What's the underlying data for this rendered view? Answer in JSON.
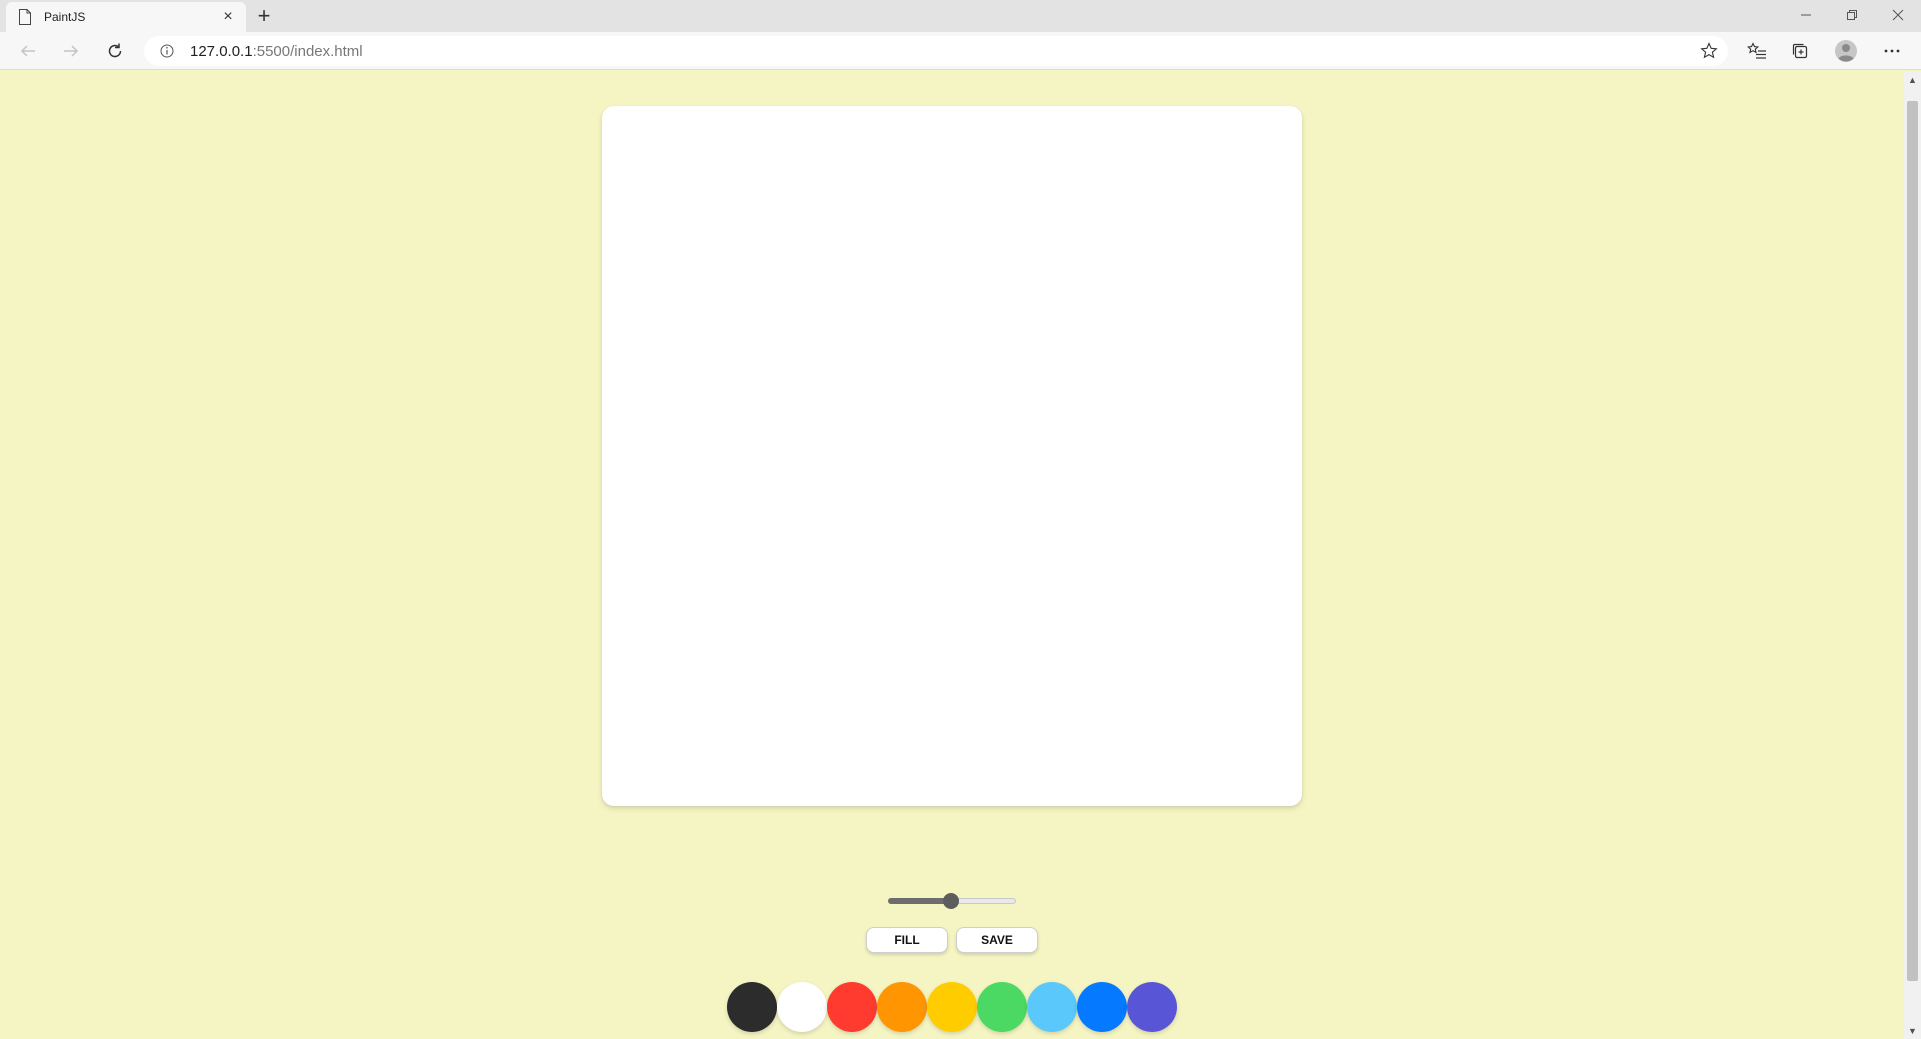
{
  "browser": {
    "tab_title": "PaintJS",
    "new_tab_label": "+",
    "close_tab_label": "×",
    "url_host": "127.0.0.1",
    "url_rest": ":5500/index.html"
  },
  "controls": {
    "brush_size": {
      "value": 5,
      "min": 0.1,
      "max": 10
    },
    "fill_label": "FILL",
    "save_label": "SAVE"
  },
  "palette": [
    {
      "name": "black",
      "color": "#2c2c2c"
    },
    {
      "name": "white",
      "color": "#ffffff"
    },
    {
      "name": "red",
      "color": "#ff3b30"
    },
    {
      "name": "orange",
      "color": "#ff9500"
    },
    {
      "name": "yellow",
      "color": "#ffcc00"
    },
    {
      "name": "green",
      "color": "#4cd963"
    },
    {
      "name": "skyblue",
      "color": "#5ac8fa"
    },
    {
      "name": "blue",
      "color": "#0579ff"
    },
    {
      "name": "purple",
      "color": "#5856d6"
    }
  ],
  "colors": {
    "page_background": "#f5f5c3",
    "canvas_background": "#ffffff"
  }
}
